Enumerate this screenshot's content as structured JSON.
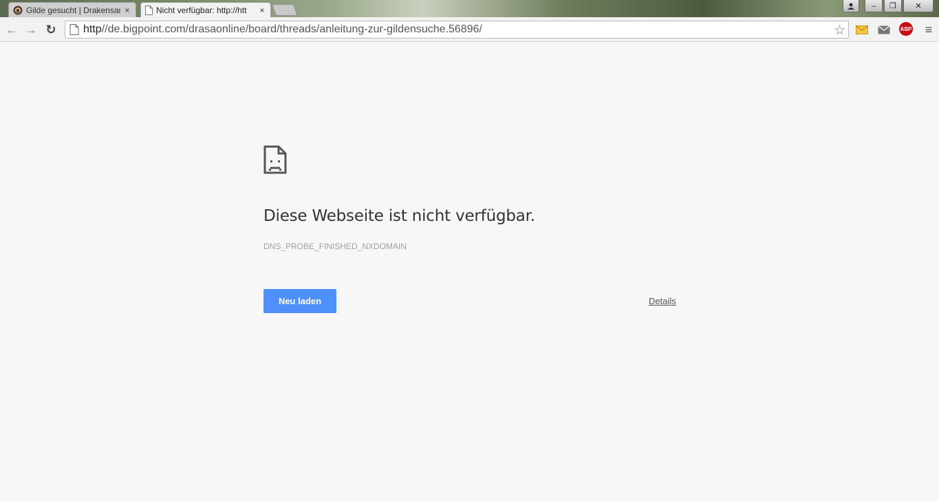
{
  "browser": {
    "tabs": [
      {
        "title": "Gilde gesucht | Drakensan",
        "active": false,
        "icon": "drakensang-favicon"
      },
      {
        "title": "Nicht verfügbar: http://htt",
        "active": true,
        "icon": "page-icon"
      }
    ],
    "close_glyph": "×",
    "window_buttons": {
      "minimize": "–",
      "maximize": "❐",
      "close": "✕"
    },
    "nav": {
      "back": "←",
      "forward": "→",
      "reload": "↻"
    },
    "url_scheme": "http",
    "url_rest": "//de.bigpoint.com/drasaonline/board/threads/anleitung-zur-gildensuche.56896/",
    "star": "☆",
    "extensions": {
      "abp_label": "ABP",
      "menu": "≡"
    }
  },
  "error_page": {
    "title": "Diese Webseite ist nicht verfügbar.",
    "code": "DNS_PROBE_FINISHED_NXDOMAIN",
    "reload_label": "Neu laden",
    "details_label": "Details"
  },
  "colors": {
    "button_blue": "#4d90fe",
    "page_bg": "#f7f7f7",
    "abp_red": "#c70d14"
  }
}
